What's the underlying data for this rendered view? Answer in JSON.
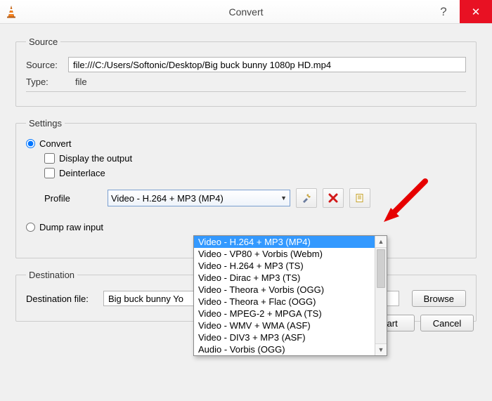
{
  "window": {
    "title": "Convert",
    "help": "?",
    "close": "✕"
  },
  "source_group": {
    "legend": "Source",
    "source_label": "Source:",
    "source_value": "file:///C:/Users/Softonic/Desktop/Big buck bunny 1080p HD.mp4",
    "type_label": "Type:",
    "type_value": "file"
  },
  "settings_group": {
    "legend": "Settings",
    "convert_label": "Convert",
    "display_output_label": "Display the output",
    "deinterlace_label": "Deinterlace",
    "profile_label": "Profile",
    "profile_selected": "Video - H.264 + MP3 (MP4)",
    "dump_raw_label": "Dump raw input"
  },
  "profile_options": [
    "Video - H.264 + MP3 (MP4)",
    "Video - VP80 + Vorbis (Webm)",
    "Video - H.264 + MP3 (TS)",
    "Video - Dirac + MP3 (TS)",
    "Video - Theora + Vorbis (OGG)",
    "Video - Theora + Flac (OGG)",
    "Video - MPEG-2 + MPGA (TS)",
    "Video - WMV + WMA (ASF)",
    "Video - DIV3 + MP3 (ASF)",
    "Audio - Vorbis (OGG)"
  ],
  "destination_group": {
    "legend": "Destination",
    "dest_label": "Destination file:",
    "dest_value": "Big buck bunny Yo",
    "browse_label": "Browse"
  },
  "footer": {
    "start_label": "Start",
    "cancel_label": "Cancel"
  },
  "icons": {
    "edit": "edit-profile-icon",
    "delete": "delete-profile-icon",
    "new": "new-profile-icon"
  }
}
